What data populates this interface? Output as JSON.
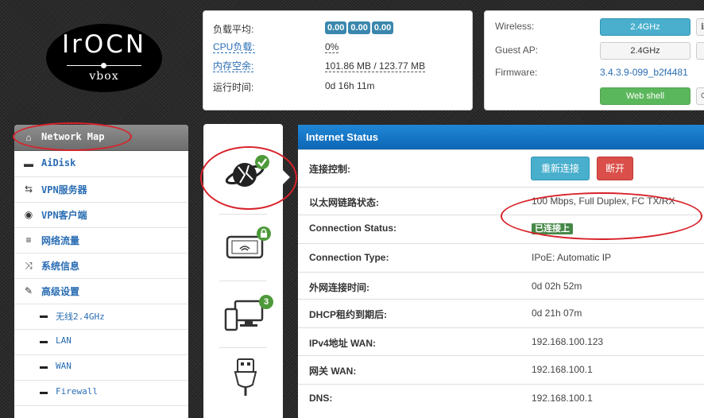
{
  "logo": {
    "brand": "IrOCN",
    "model": "vbox"
  },
  "system": {
    "rows": [
      {
        "label": "负载平均:",
        "badges": [
          "0.00",
          "0.00",
          "0.00"
        ]
      },
      {
        "label": "CPU负载:",
        "value": "0%"
      },
      {
        "label": "内存空余:",
        "value": "101.86 MB / 123.77 MB"
      },
      {
        "label": "运行时间:",
        "value": "0d 16h 11m"
      }
    ]
  },
  "device": {
    "wireless_label": "Wireless:",
    "wireless_btn": "2.4GHz",
    "guest_label": "Guest AP:",
    "guest_btn": "2.4GHz",
    "firmware_label": "Firmware:",
    "firmware_value": "3.4.3.9-099_b2f4481",
    "webshell_btn": "Web shell"
  },
  "sidebar": {
    "items": [
      {
        "label": "Network Map",
        "icon": "home-icon",
        "glyph": "⌂",
        "active": true
      },
      {
        "label": "AiDisk",
        "icon": "disk-icon",
        "glyph": "▬"
      },
      {
        "label": "VPN服务器",
        "icon": "exchange-icon",
        "glyph": "⇆"
      },
      {
        "label": "VPN客户端",
        "icon": "globe-icon",
        "glyph": "◉"
      },
      {
        "label": "网络流量",
        "icon": "list-icon",
        "glyph": "≡"
      },
      {
        "label": "系统信息",
        "icon": "shuffle-icon",
        "glyph": "⤨"
      },
      {
        "label": "高级设置",
        "icon": "wrench-icon",
        "glyph": "✎"
      }
    ],
    "subitems": [
      {
        "label": "无线2.4GHz"
      },
      {
        "label": "LAN"
      },
      {
        "label": "WAN"
      },
      {
        "label": "Firewall"
      }
    ]
  },
  "tabs": {
    "wifi_lock_badge": "",
    "clients_count": "3"
  },
  "internet_status": {
    "title": "Internet Status",
    "reconnect_btn": "重新连接",
    "disconnect_btn": "断开",
    "rows": [
      {
        "key": "连接控制:"
      },
      {
        "key": "以太网链路状态:",
        "value": "100 Mbps, Full Duplex, FC TX/RX"
      },
      {
        "key": "Connection Status:",
        "value": "已连接上"
      },
      {
        "key": "Connection Type:",
        "value": "IPoE: Automatic IP"
      },
      {
        "key": "外网连接时间:",
        "value": "0d 02h 52m"
      },
      {
        "key": "DHCP租约到期后:",
        "value": "0d 21h 07m"
      },
      {
        "key": "IPv4地址 WAN:",
        "value": "192.168.100.123"
      },
      {
        "key": "网关 WAN:",
        "value": "192.168.100.1"
      },
      {
        "key": "DNS:",
        "value": "192.168.100.1"
      }
    ]
  },
  "colors": {
    "header_blue": "#0d66b5",
    "info_button": "#49afcd",
    "danger_button": "#da4f49",
    "success_button": "#5bb75b",
    "annotation_red": "#d8222a"
  }
}
